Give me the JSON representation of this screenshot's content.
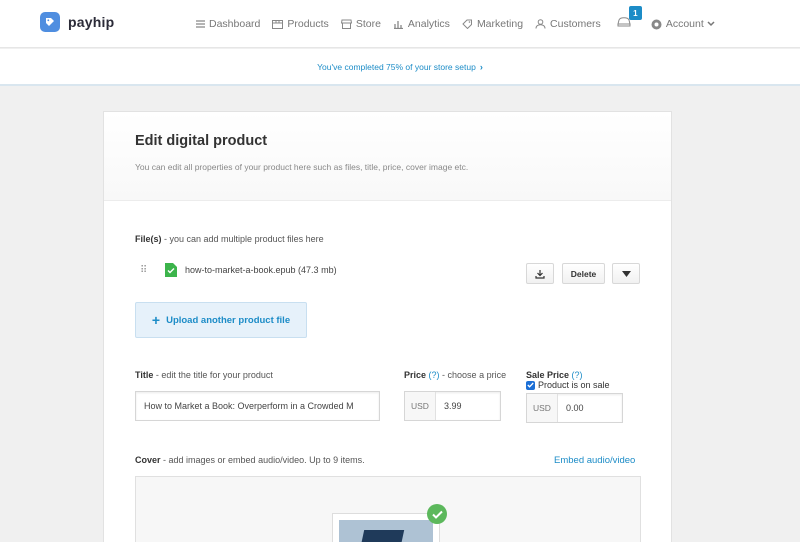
{
  "app": {
    "logo_text": "payhip",
    "nav": [
      {
        "label": "Dashboard",
        "icon": "menu-icon"
      },
      {
        "label": "Products",
        "icon": "box-icon"
      },
      {
        "label": "Store",
        "icon": "store-icon"
      },
      {
        "label": "Analytics",
        "icon": "chart-icon"
      },
      {
        "label": "Marketing",
        "icon": "tag-icon"
      },
      {
        "label": "Customers",
        "icon": "user-icon"
      }
    ],
    "notification_count": "1",
    "account_label": "Account"
  },
  "setup_bar": {
    "text": "You've completed 75% of your store setup",
    "chevron": "›",
    "progress_percent": 75
  },
  "page": {
    "title": "Edit digital product",
    "subtitle": "You can edit all properties of your product here such as files, title, price, cover image etc."
  },
  "files": {
    "label": "File(s)",
    "hint": " - you can add multiple product files here",
    "items": [
      {
        "name": "how-to-market-a-book.epub (47.3 mb)"
      }
    ],
    "delete_label": "Delete",
    "upload_label": "Upload another product file"
  },
  "title_field": {
    "label": "Title",
    "hint": " - edit the title for your product",
    "value": "How to Market a Book: Overperform in a Crowded M"
  },
  "price_field": {
    "label": "Price",
    "help": "(?)",
    "hint": " - choose a price",
    "currency": "USD",
    "value": "3.99"
  },
  "sale_field": {
    "label": "Sale Price",
    "help": "(?)",
    "on_sale_label": "Product is on sale",
    "on_sale_checked": true,
    "currency": "USD",
    "value": "0.00"
  },
  "cover": {
    "label": "Cover",
    "hint": " - add images or embed audio/video. Up to 9 items.",
    "embed_link": "Embed audio/video"
  },
  "colors": {
    "accent": "#1c8cc7",
    "logo": "#4f8ee0",
    "success": "#5cb85c"
  }
}
